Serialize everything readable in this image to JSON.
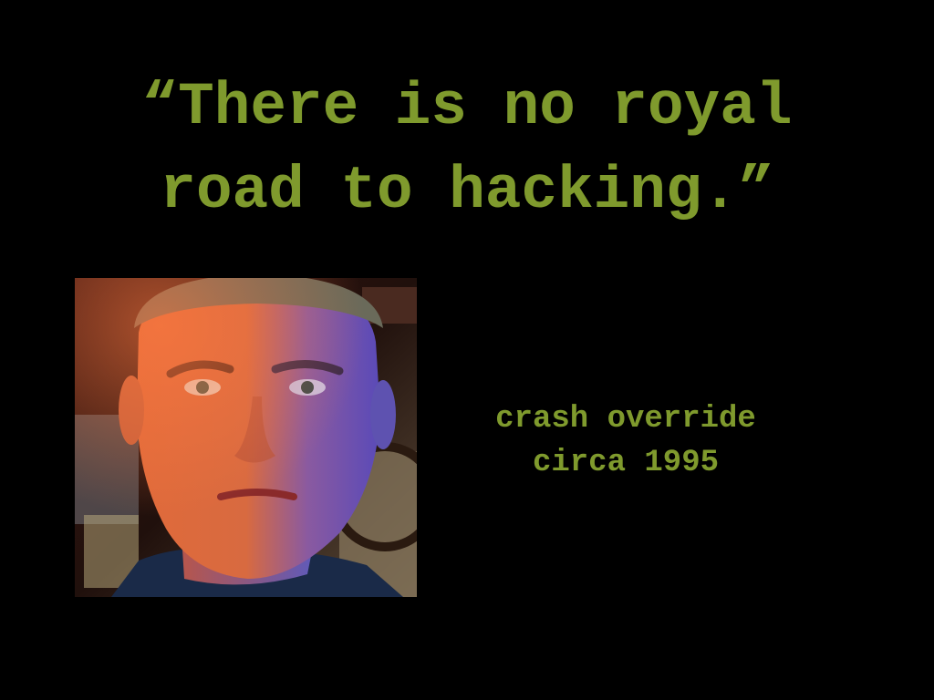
{
  "slide": {
    "quote_lines": [
      "“There is no royal",
      "road to hacking.”"
    ],
    "attribution": {
      "name": "crash override",
      "date": "circa 1995"
    },
    "photo": {
      "description_icon": "portrait-photo"
    },
    "colors": {
      "background": "#000000",
      "text": "#7f9a2d"
    }
  }
}
